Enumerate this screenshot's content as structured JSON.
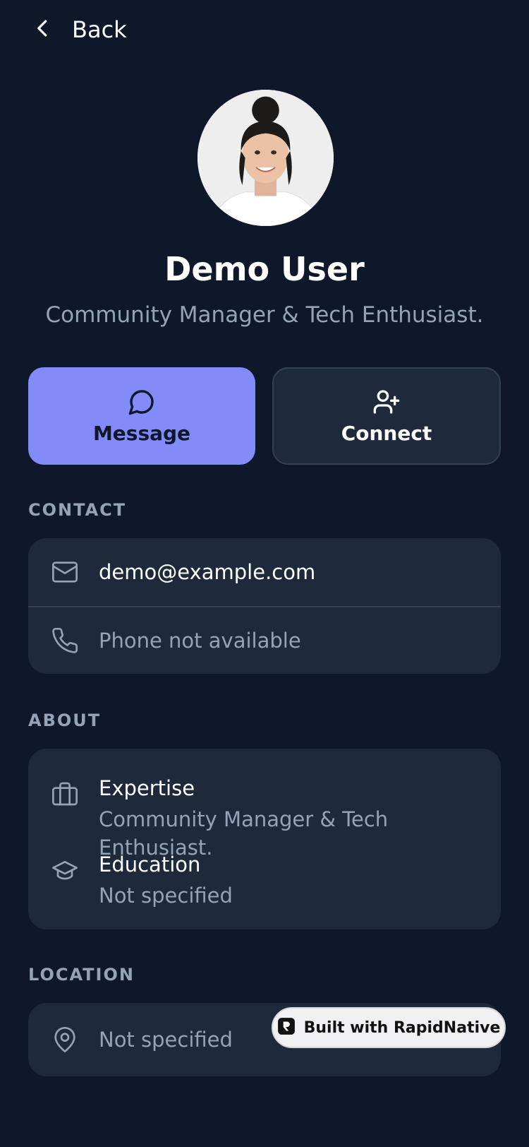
{
  "nav": {
    "back_label": "Back"
  },
  "profile": {
    "name": "Demo User",
    "tagline": "Community Manager & Tech Enthusiast."
  },
  "actions": {
    "message_label": "Message",
    "connect_label": "Connect"
  },
  "contact": {
    "title": "CONTACT",
    "email": "demo@example.com",
    "phone": "Phone not available"
  },
  "about": {
    "title": "ABOUT",
    "expertise_label": "Expertise",
    "expertise_value": "Community Manager & Tech Enthusiast.",
    "education_label": "Education",
    "education_value": "Not specified"
  },
  "location": {
    "title": "LOCATION",
    "value": "Not specified"
  },
  "badge": {
    "label": "Built with RapidNative"
  },
  "colors": {
    "background": "#0f172a",
    "card": "#1e293b",
    "accent": "#818cf8",
    "muted": "#94a3b8"
  }
}
